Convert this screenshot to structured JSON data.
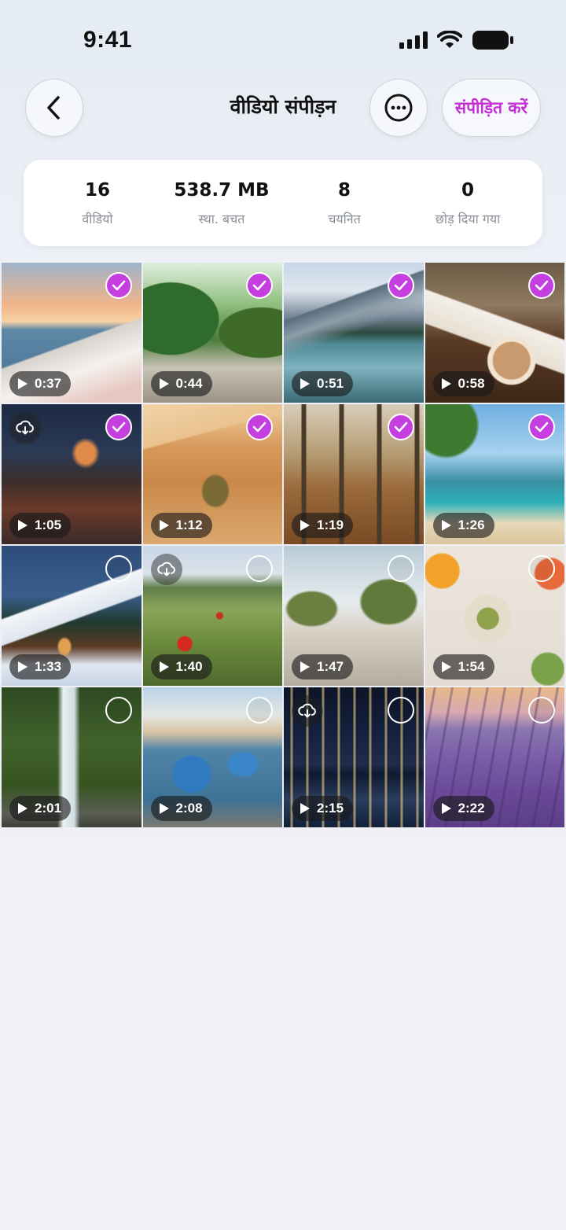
{
  "status_bar": {
    "time": "9:41"
  },
  "header": {
    "title": "वीडियो संपीड़न",
    "compress_label": "संपीड़ित करें",
    "back_icon": "chevron-left-icon",
    "more_icon": "more-horizontal-icon"
  },
  "stats": [
    {
      "value": "16",
      "label": "वीडियो"
    },
    {
      "value": "538.7 MB",
      "label": "स्था. बचत"
    },
    {
      "value": "8",
      "label": "चयनित"
    },
    {
      "value": "0",
      "label": "छोड़ दिया गया"
    }
  ],
  "accent_color": "#c43ee0",
  "videos": [
    {
      "duration": "0:37",
      "selected": true,
      "cloud": false,
      "scene": "coastal-village-sunset"
    },
    {
      "duration": "0:44",
      "selected": true,
      "cloud": false,
      "scene": "greenhouse-path"
    },
    {
      "duration": "0:51",
      "selected": true,
      "cloud": false,
      "scene": "mountain-lake-dock"
    },
    {
      "duration": "0:58",
      "selected": true,
      "cloud": false,
      "scene": "coffee-book"
    },
    {
      "duration": "1:05",
      "selected": true,
      "cloud": true,
      "scene": "rainy-street-night"
    },
    {
      "duration": "1:12",
      "selected": true,
      "cloud": false,
      "scene": "desert-dune"
    },
    {
      "duration": "1:19",
      "selected": true,
      "cloud": false,
      "scene": "autumn-forest"
    },
    {
      "duration": "1:26",
      "selected": true,
      "cloud": false,
      "scene": "tropical-beach"
    },
    {
      "duration": "1:33",
      "selected": false,
      "cloud": false,
      "scene": "snowy-cabin"
    },
    {
      "duration": "1:40",
      "selected": false,
      "cloud": true,
      "scene": "poppy-meadow"
    },
    {
      "duration": "1:47",
      "selected": false,
      "cloud": false,
      "scene": "modern-atrium"
    },
    {
      "duration": "1:54",
      "selected": false,
      "cloud": false,
      "scene": "breakfast-table"
    },
    {
      "duration": "2:01",
      "selected": false,
      "cloud": false,
      "scene": "waterfall"
    },
    {
      "duration": "2:08",
      "selected": false,
      "cloud": false,
      "scene": "harbor-boats"
    },
    {
      "duration": "2:15",
      "selected": false,
      "cloud": true,
      "scene": "city-night"
    },
    {
      "duration": "2:22",
      "selected": false,
      "cloud": false,
      "scene": "lavender-field"
    }
  ]
}
